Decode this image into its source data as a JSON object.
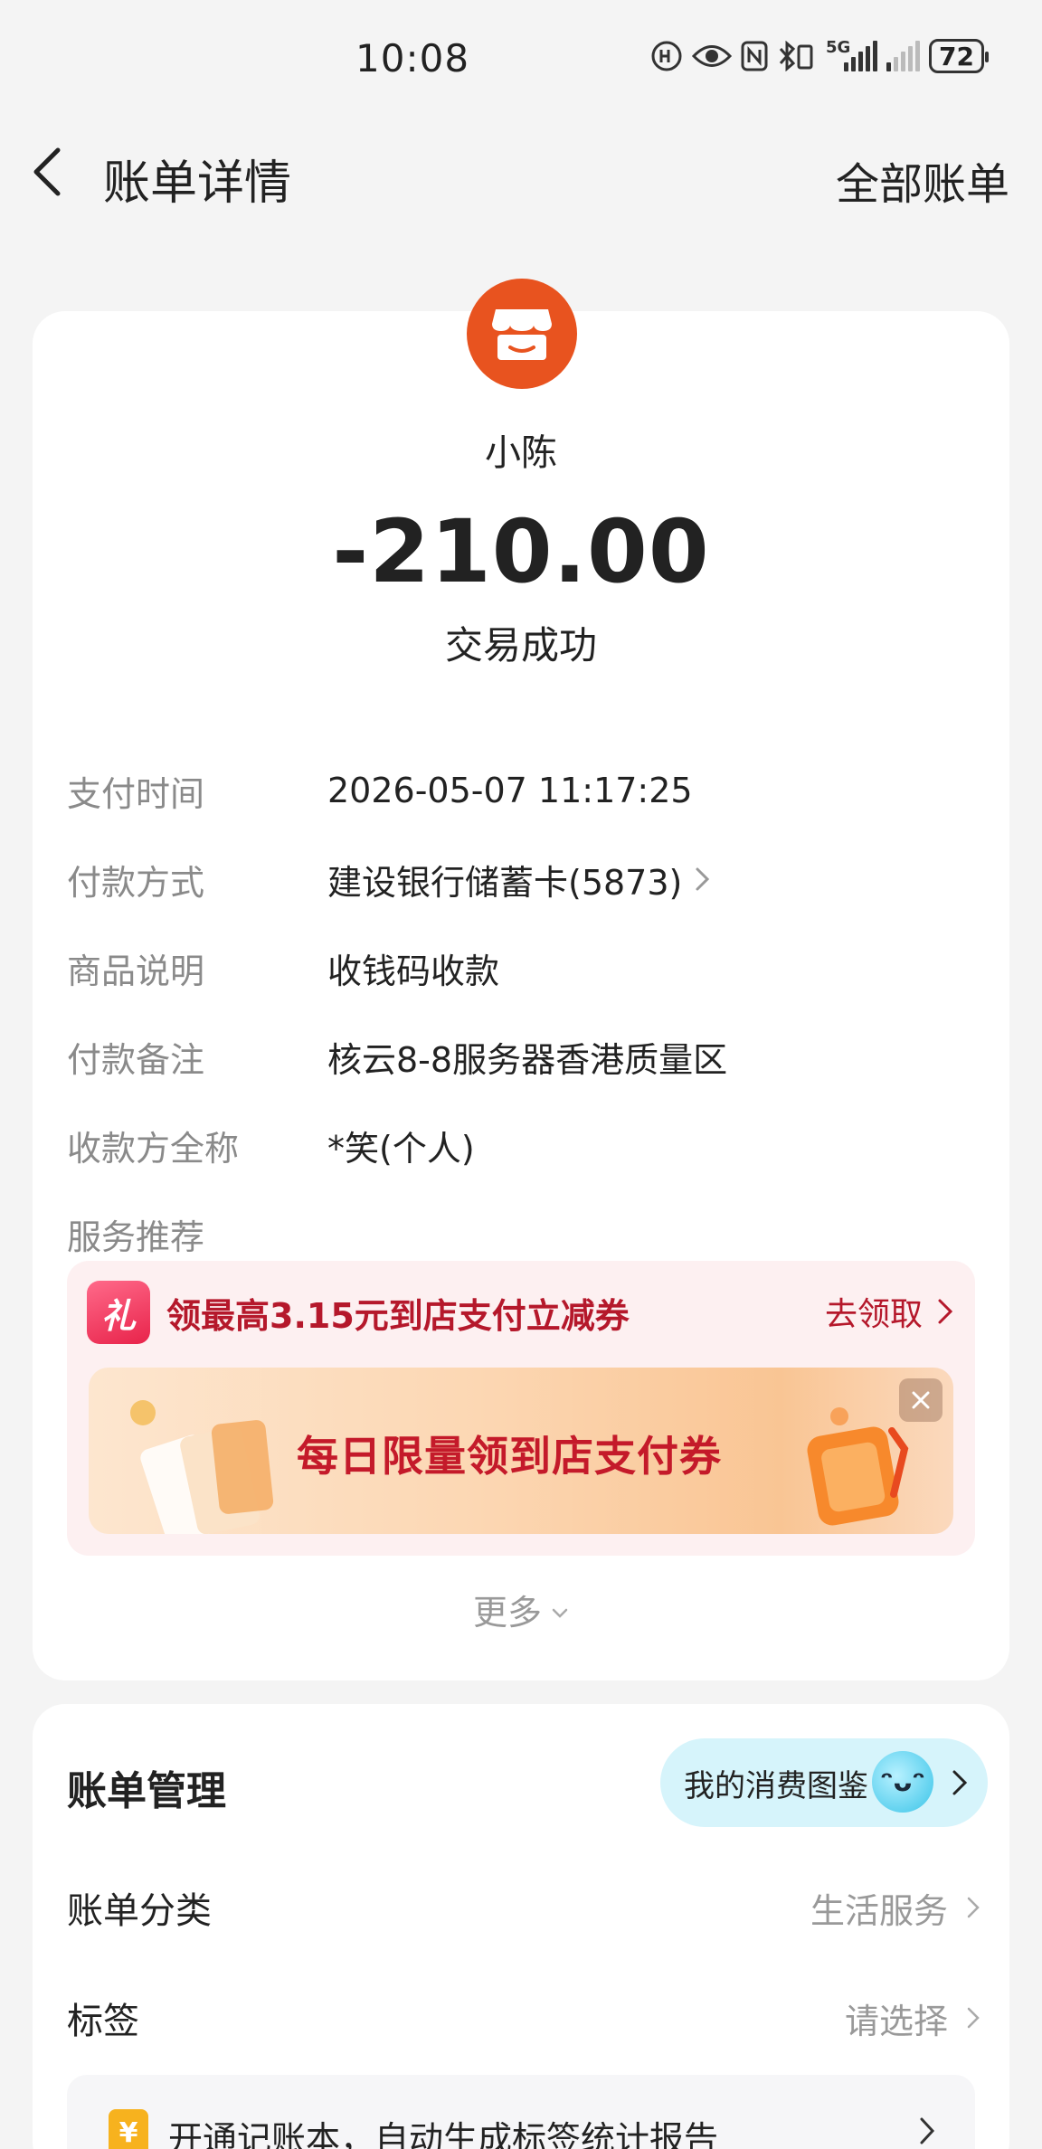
{
  "status_bar": {
    "time": "10:08",
    "network": "5G",
    "battery": "72"
  },
  "header": {
    "title": "账单详情",
    "all_bills": "全部账单"
  },
  "transaction": {
    "merchant": "小陈",
    "amount": "-210.00",
    "status": "交易成功",
    "merchant_icon": "store-icon",
    "brand_color": "#e8531f"
  },
  "details": [
    {
      "label": "支付时间",
      "value": "2026-05-07 11:17:25"
    },
    {
      "label": "付款方式",
      "value": "建设银行储蓄卡(5873)"
    },
    {
      "label": "商品说明",
      "value": "收钱码收款"
    },
    {
      "label": "付款备注",
      "value": "核云8-8服务器香港质量区"
    },
    {
      "label": "收款方全称",
      "value": "*笑(个人)"
    },
    {
      "label": "服务推荐",
      "value": ""
    }
  ],
  "promo": {
    "gift_icon_text": "礼",
    "text": "领最高3.15元到店支付立减券",
    "claim_label": "去领取",
    "banner_text": "每日限量领到店支付券",
    "accent_color": "#b5182b"
  },
  "more_label": "更多",
  "management": {
    "title": "账单管理",
    "pill_label": "我的消费图鉴",
    "rows": [
      {
        "label": "账单分类",
        "value": "生活服务"
      },
      {
        "label": "标签",
        "value": "请选择"
      }
    ],
    "notice_icon": "¥",
    "notice_text": "开通记账本，自动生成标签统计报告"
  }
}
